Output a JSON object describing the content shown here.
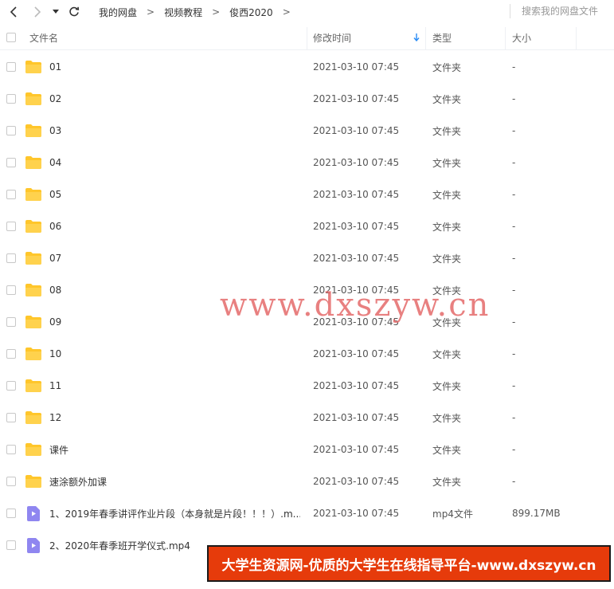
{
  "toolbar": {
    "breadcrumbs": [
      "我的网盘",
      "视频教程",
      "俊西2020"
    ],
    "search_placeholder": "搜索我的网盘文件"
  },
  "columns": {
    "name": "文件名",
    "modified": "修改时间",
    "type": "类型",
    "size": "大小"
  },
  "rows": [
    {
      "name": "01",
      "modified": "2021-03-10 07:45",
      "type": "文件夹",
      "size": "-",
      "icon": "folder-icon"
    },
    {
      "name": "02",
      "modified": "2021-03-10 07:45",
      "type": "文件夹",
      "size": "-",
      "icon": "folder-icon"
    },
    {
      "name": "03",
      "modified": "2021-03-10 07:45",
      "type": "文件夹",
      "size": "-",
      "icon": "folder-icon"
    },
    {
      "name": "04",
      "modified": "2021-03-10 07:45",
      "type": "文件夹",
      "size": "-",
      "icon": "folder-icon"
    },
    {
      "name": "05",
      "modified": "2021-03-10 07:45",
      "type": "文件夹",
      "size": "-",
      "icon": "folder-icon"
    },
    {
      "name": "06",
      "modified": "2021-03-10 07:45",
      "type": "文件夹",
      "size": "-",
      "icon": "folder-icon"
    },
    {
      "name": "07",
      "modified": "2021-03-10 07:45",
      "type": "文件夹",
      "size": "-",
      "icon": "folder-icon"
    },
    {
      "name": "08",
      "modified": "2021-03-10 07:45",
      "type": "文件夹",
      "size": "-",
      "icon": "folder-icon"
    },
    {
      "name": "09",
      "modified": "2021-03-10 07:45",
      "type": "文件夹",
      "size": "-",
      "icon": "folder-icon"
    },
    {
      "name": "10",
      "modified": "2021-03-10 07:45",
      "type": "文件夹",
      "size": "-",
      "icon": "folder-icon"
    },
    {
      "name": "11",
      "modified": "2021-03-10 07:45",
      "type": "文件夹",
      "size": "-",
      "icon": "folder-icon"
    },
    {
      "name": "12",
      "modified": "2021-03-10 07:45",
      "type": "文件夹",
      "size": "-",
      "icon": "folder-icon"
    },
    {
      "name": "课件",
      "modified": "2021-03-10 07:45",
      "type": "文件夹",
      "size": "-",
      "icon": "folder-icon"
    },
    {
      "name": "速涂额外加课",
      "modified": "2021-03-10 07:45",
      "type": "文件夹",
      "size": "-",
      "icon": "folder-icon"
    },
    {
      "name": "1、2019年春季讲评作业片段（本身就是片段！！！）.m...",
      "modified": "2021-03-10 07:45",
      "type": "mp4文件",
      "size": "899.17MB",
      "icon": "video-file-icon"
    },
    {
      "name": "2、2020年春季班开学仪式.mp4",
      "modified": "",
      "type": "",
      "size": "",
      "icon": "video-file-icon"
    }
  ],
  "watermark": "www.dxszyw.cn",
  "banner": "大学生资源网-优质的大学生在线指导平台-www.dxszyw.cn",
  "colors": {
    "folder": "#ffc62b",
    "video": "#8f86f0",
    "sort_arrow": "#2a8cf5",
    "banner_bg": "#e63b0b"
  }
}
